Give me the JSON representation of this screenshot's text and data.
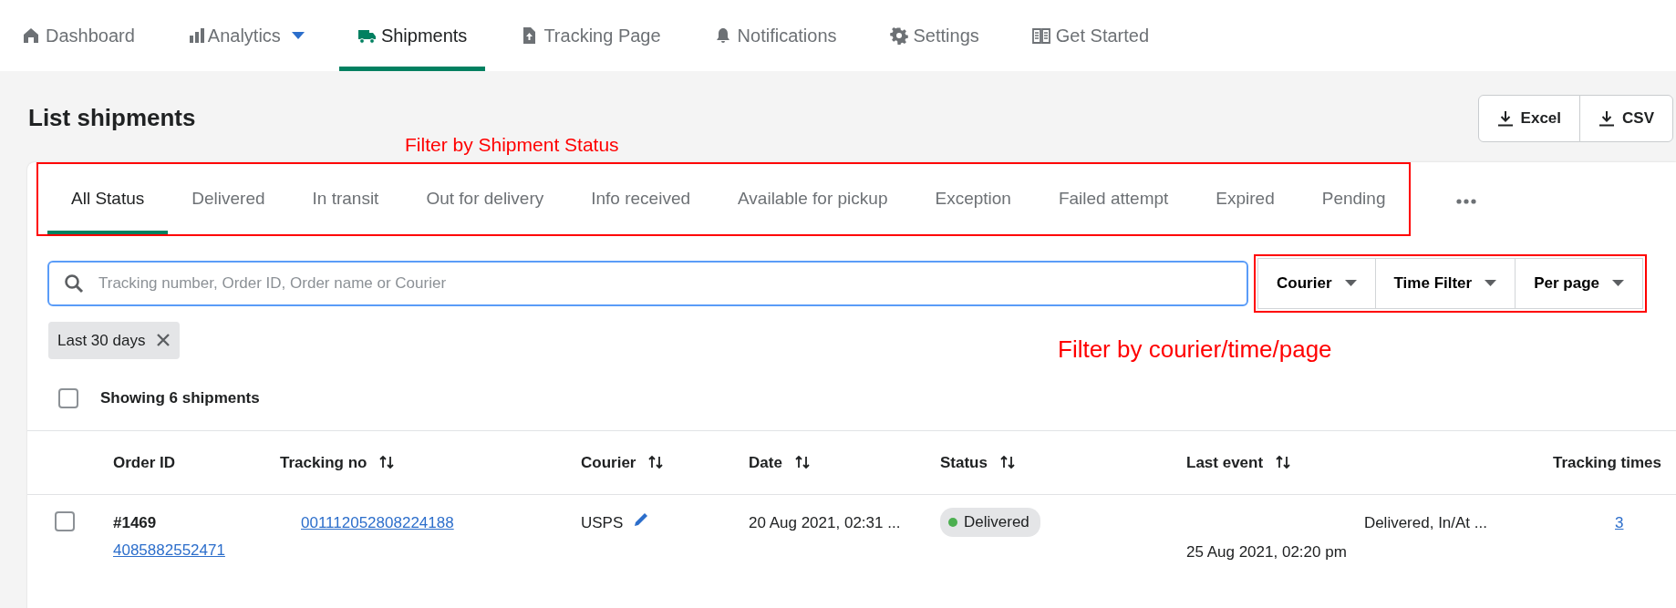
{
  "nav": [
    {
      "label": "Dashboard",
      "selected": false,
      "dropdown": false
    },
    {
      "label": "Analytics",
      "selected": false,
      "dropdown": true
    },
    {
      "label": "Shipments",
      "selected": true,
      "dropdown": false
    },
    {
      "label": "Tracking Page",
      "selected": false,
      "dropdown": false
    },
    {
      "label": "Notifications",
      "selected": false,
      "dropdown": false
    },
    {
      "label": "Settings",
      "selected": false,
      "dropdown": false
    },
    {
      "label": "Get Started",
      "selected": false,
      "dropdown": false
    }
  ],
  "page_title": "List shipments",
  "export_buttons": [
    "Excel",
    "CSV"
  ],
  "status_tabs": {
    "annotation": "Filter by Shipment Status",
    "tabs": [
      {
        "label": "All Status",
        "selected": true
      },
      {
        "label": "Delivered",
        "selected": false
      },
      {
        "label": "In transit",
        "selected": false
      },
      {
        "label": "Out for delivery",
        "selected": false
      },
      {
        "label": "Info received",
        "selected": false
      },
      {
        "label": "Available for pickup",
        "selected": false
      },
      {
        "label": "Exception",
        "selected": false
      },
      {
        "label": "Failed attempt",
        "selected": false
      },
      {
        "label": "Expired",
        "selected": false
      },
      {
        "label": "Pending",
        "selected": false
      }
    ]
  },
  "search": {
    "placeholder": "Tracking number, Order ID, Order name or Courier"
  },
  "filters": {
    "annotation": "Filter by courier/time/page",
    "dropdowns": [
      "Courier",
      "Time Filter",
      "Per page"
    ]
  },
  "chips": [
    {
      "label": "Last 30 days"
    }
  ],
  "select_all": {
    "checked": false,
    "label": "Showing 6 shipments"
  },
  "table": {
    "columns": [
      {
        "label": "Order ID",
        "sortable": false
      },
      {
        "label": "Tracking no",
        "sortable": true
      },
      {
        "label": "Courier",
        "sortable": true
      },
      {
        "label": "Date",
        "sortable": true
      },
      {
        "label": "Status",
        "sortable": true
      },
      {
        "label": "Last event",
        "sortable": true
      },
      {
        "label": "Tracking times",
        "sortable": false
      }
    ],
    "rows": [
      {
        "checked": false,
        "order_id": "#1469",
        "order_number": "4085882552471",
        "tracking_no": "001112052808224188",
        "courier": "USPS",
        "date": "20 Aug 2021, 02:31 ...",
        "status": "Delivered",
        "color": "#4caf50",
        "last_event": "Delivered, In/At ...",
        "last_event_time": "25 Aug 2021, 02:20 pm",
        "tracking_times": "3"
      }
    ]
  }
}
